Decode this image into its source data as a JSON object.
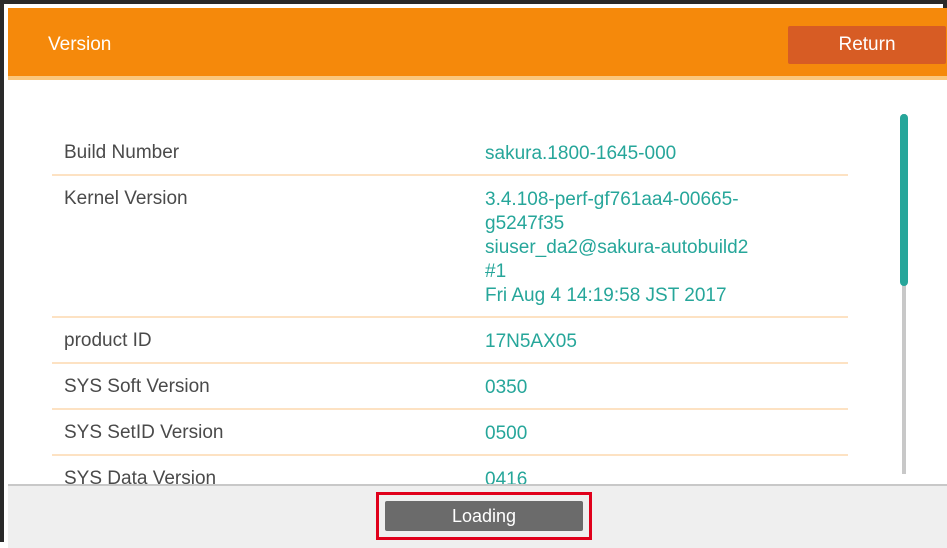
{
  "header": {
    "title": "Version",
    "return_label": "Return"
  },
  "rows": [
    {
      "label": "Build Number",
      "value_lines": [
        "sakura.1800-1645-000"
      ]
    },
    {
      "label": "Kernel Version",
      "value_lines": [
        "3.4.108-perf-gf761aa4-00665-",
        "g5247f35",
        "siuser_da2@sakura-autobuild2",
        "#1",
        "Fri Aug 4 14:19:58 JST 2017"
      ]
    },
    {
      "label": "product ID",
      "value_lines": [
        "17N5AX05"
      ]
    },
    {
      "label": "SYS Soft Version",
      "value_lines": [
        "0350"
      ]
    },
    {
      "label": "SYS SetID Version",
      "value_lines": [
        "0500"
      ]
    },
    {
      "label": "SYS Data Version",
      "value_lines": [
        "0416"
      ]
    }
  ],
  "footer": {
    "loading_label": "Loading"
  },
  "colors": {
    "header_bg": "#f5890b",
    "return_button_bg": "#d75c24",
    "value_text": "#26a69a",
    "highlight_border": "#e0001b",
    "loading_button_bg": "#6b6b6b"
  },
  "icons": []
}
